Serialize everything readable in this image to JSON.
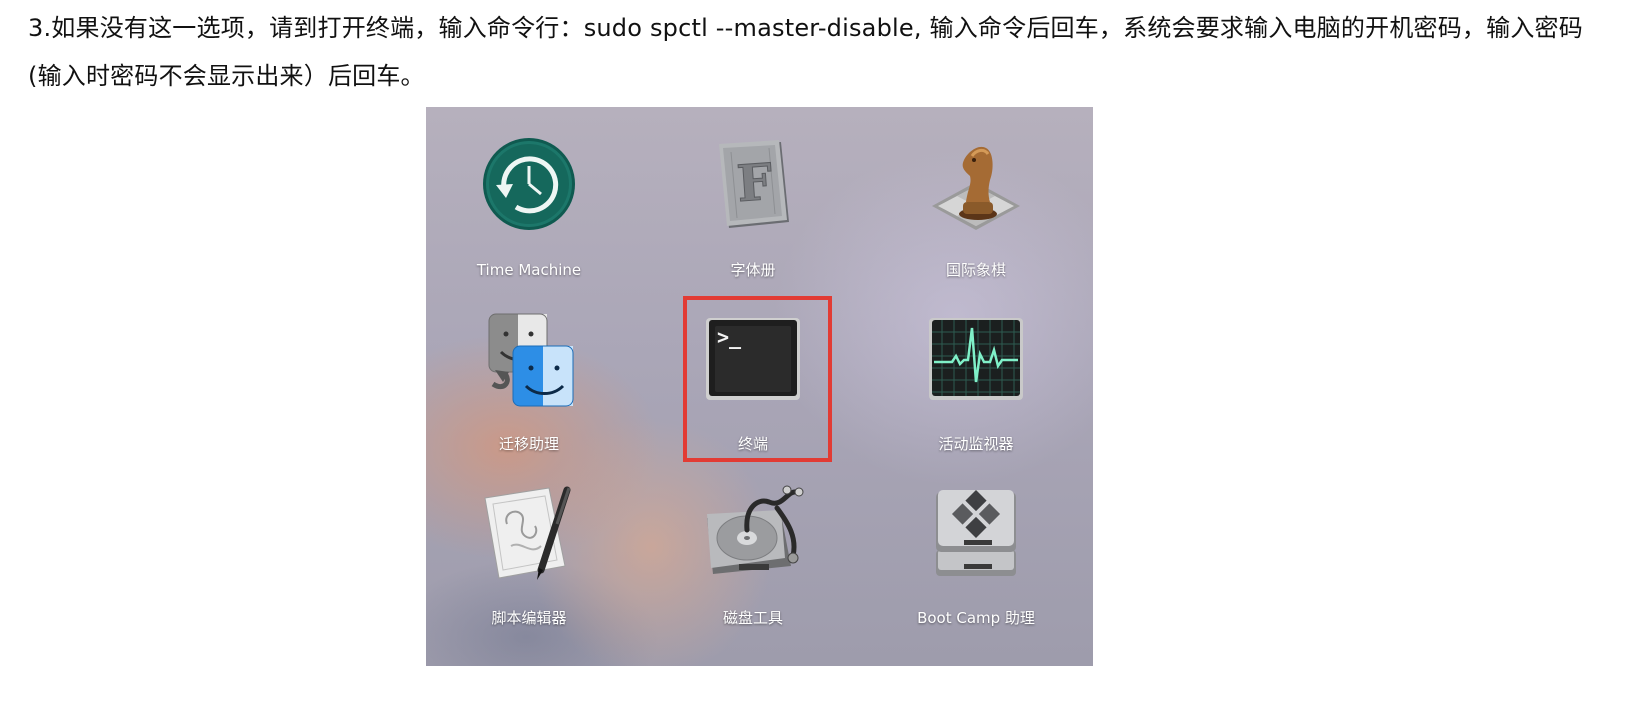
{
  "document": {
    "instruction": "3.如果没有这一选项，请到打开终端，输入命令行：sudo spctl --master-disable, 输入命令后回车，系统会要求输入电脑的开机密码，输入密码(输入时密码不会显示出来）后回车。"
  },
  "launchpad": {
    "apps": [
      {
        "label": "Time Machine",
        "icon": "time-machine-icon"
      },
      {
        "label": "字体册",
        "icon": "font-book-icon"
      },
      {
        "label": "国际象棋",
        "icon": "chess-icon"
      },
      {
        "label": "迁移助理",
        "icon": "migration-assistant-icon"
      },
      {
        "label": "终端",
        "icon": "terminal-icon"
      },
      {
        "label": "活动监视器",
        "icon": "activity-monitor-icon"
      },
      {
        "label": "脚本编辑器",
        "icon": "script-editor-icon"
      },
      {
        "label": "磁盘工具",
        "icon": "disk-utility-icon"
      },
      {
        "label": "Boot Camp 助理",
        "icon": "boot-camp-icon"
      }
    ],
    "highlighted_app": "终端",
    "highlight_color": "#e23b34",
    "terminal_prompt": ">_"
  }
}
